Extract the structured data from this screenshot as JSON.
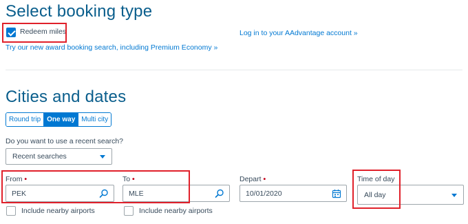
{
  "booking_type": {
    "title": "Select booking type",
    "redeem_label": "Redeem miles",
    "redeem_checked": true,
    "login_link": "Log in to your AAdvantage account »",
    "award_link": "Try our new award booking search, including Premium Economy »"
  },
  "cities": {
    "title": "Cities and dates",
    "trip_tabs": [
      {
        "label": "Round trip",
        "active": false
      },
      {
        "label": "One way",
        "active": true
      },
      {
        "label": "Multi city",
        "active": false
      }
    ],
    "recent_prompt": "Do you want to use a recent search?",
    "recent_select_value": "Recent searches",
    "from": {
      "label": "From",
      "required_mark": "•",
      "value": "PEK",
      "nearby_label": "Include nearby airports",
      "icon": "search-icon"
    },
    "to": {
      "label": "To",
      "required_mark": "•",
      "value": "MLE",
      "nearby_label": "Include nearby airports",
      "icon": "search-icon"
    },
    "depart": {
      "label": "Depart",
      "required_mark": "•",
      "value": "10/01/2020",
      "icon": "calendar-icon"
    },
    "time_of_day": {
      "label": "Time of day",
      "value": "All day"
    }
  },
  "colors": {
    "accent": "#0078d2",
    "heading": "#0a5e8c",
    "highlight": "#e0202a",
    "required": "#c30019"
  }
}
